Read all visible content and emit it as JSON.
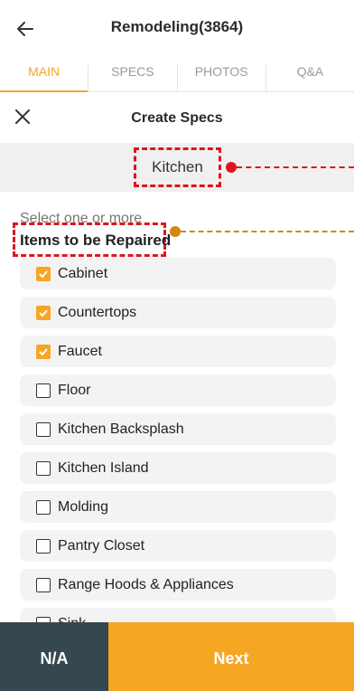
{
  "header": {
    "title": "Remodeling(3864)"
  },
  "tabs": [
    {
      "label": "MAIN",
      "active": true
    },
    {
      "label": "SPECS",
      "active": false
    },
    {
      "label": "PHOTOS",
      "active": false
    },
    {
      "label": "Q&A",
      "active": false
    }
  ],
  "subheader": {
    "title": "Create Specs"
  },
  "room": {
    "name": "Kitchen"
  },
  "section": {
    "hint": "Select one or more",
    "title": "Items to be Repaired"
  },
  "items": [
    {
      "label": "Cabinet",
      "checked": true
    },
    {
      "label": "Countertops",
      "checked": true
    },
    {
      "label": "Faucet",
      "checked": true
    },
    {
      "label": "Floor",
      "checked": false
    },
    {
      "label": "Kitchen Backsplash",
      "checked": false
    },
    {
      "label": "Kitchen Island",
      "checked": false
    },
    {
      "label": "Molding",
      "checked": false
    },
    {
      "label": "Pantry Closet",
      "checked": false
    },
    {
      "label": "Range Hoods & Appliances",
      "checked": false
    },
    {
      "label": "Sink",
      "checked": false
    }
  ],
  "footer": {
    "na_label": "N/A",
    "next_label": "Next"
  },
  "colors": {
    "accent": "#f5a623",
    "dark": "#37474f",
    "annotation_red": "#e0141e",
    "annotation_orange": "#d4870d"
  },
  "icons": {
    "back": "arrow-left-icon",
    "close": "close-icon",
    "checked": "checkbox-checked-icon",
    "unchecked": "checkbox-empty-icon"
  }
}
